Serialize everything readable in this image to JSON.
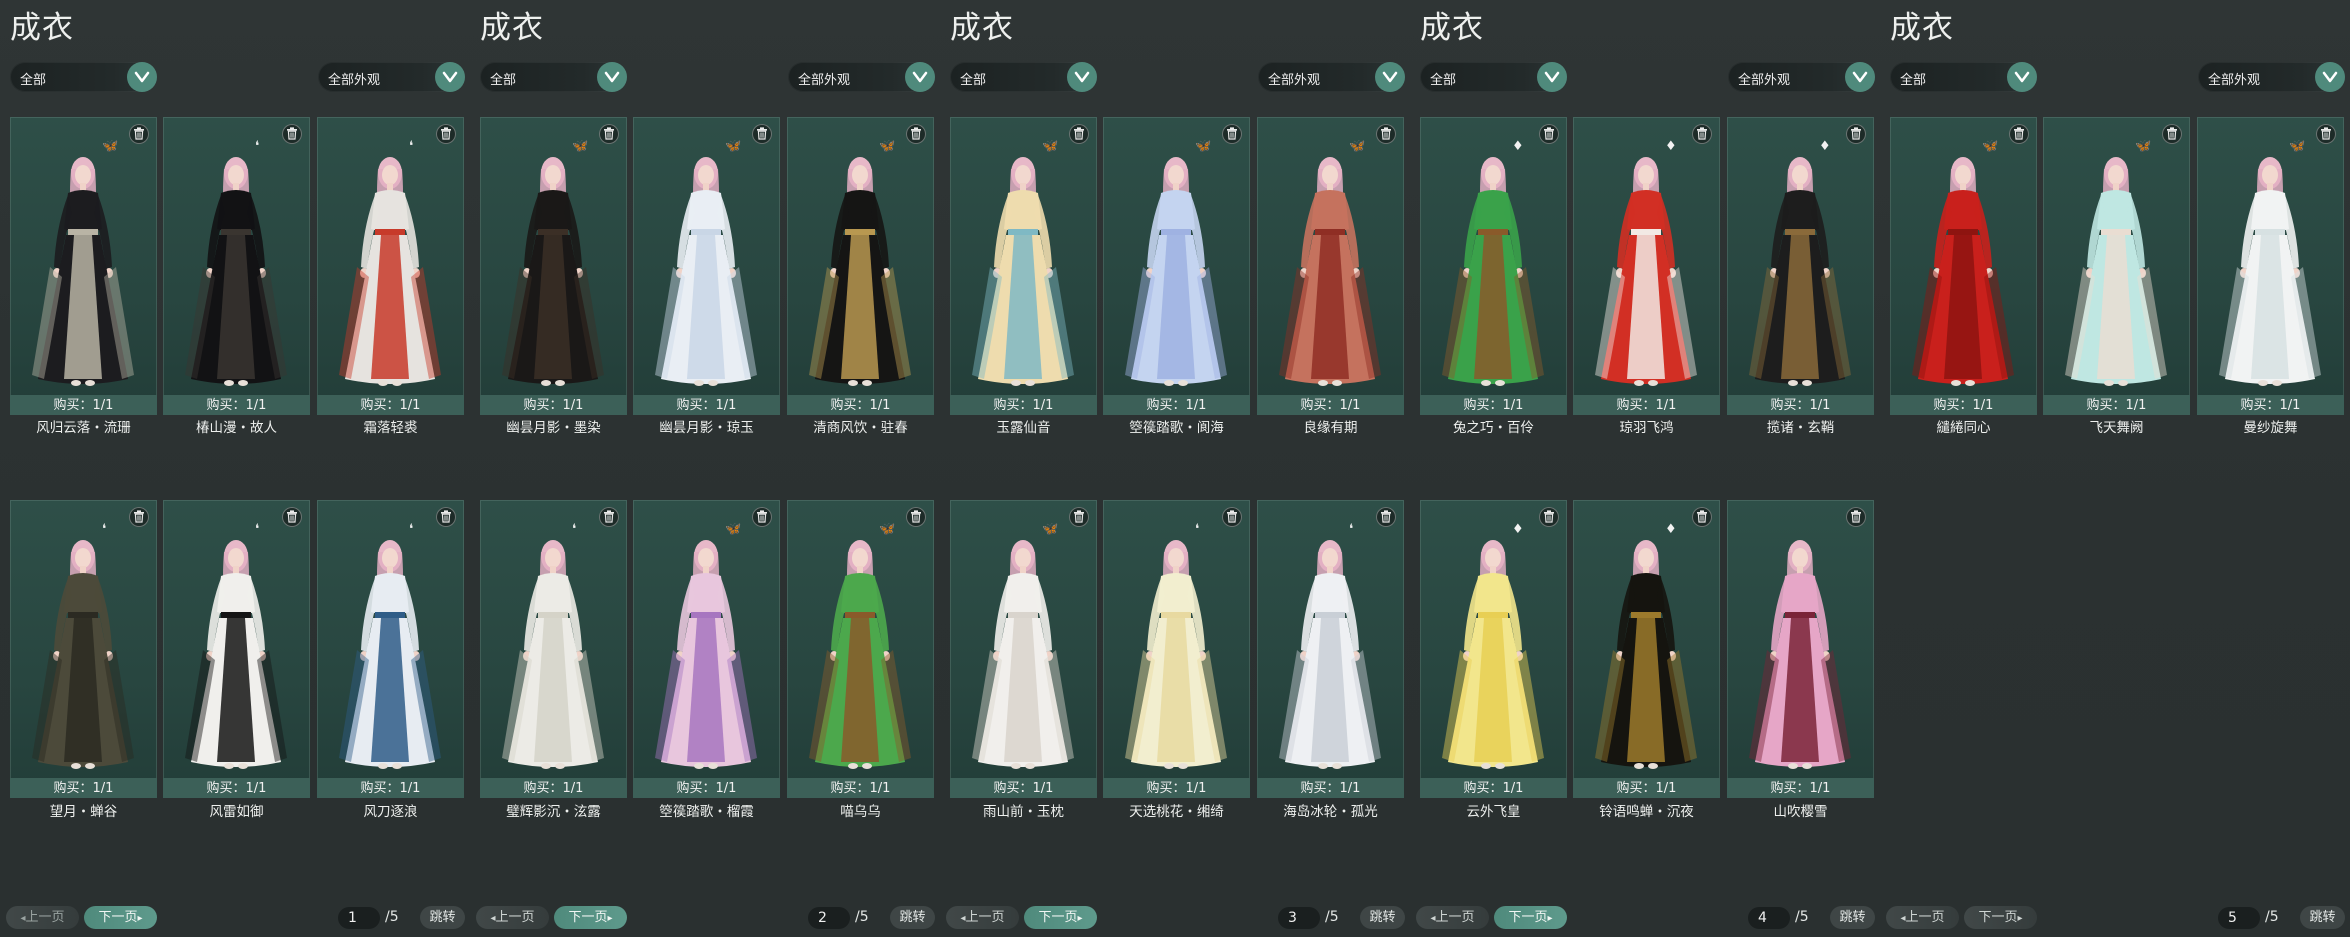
{
  "colors": {
    "accent": "#4f8a7c",
    "panel_bg": "#2c3333",
    "card_bg": "#2e4f48",
    "card_footer": "#3c6058"
  },
  "panels": [
    {
      "title": "成衣",
      "filter_left": "全部",
      "filter_right": "全部外观",
      "pager": {
        "prev": "上一页",
        "next": "下一页",
        "page": "1",
        "total": "/5",
        "jump": "跳转",
        "prev_enabled": false,
        "next_enabled": true
      },
      "cards": [
        {
          "name": "风归云落・流珊",
          "limit": "购买：1/1",
          "icon": "butterfly-icon",
          "dress": [
            "#1c1c1f",
            "#b9b4a5"
          ]
        },
        {
          "name": "椿山漫・故人",
          "limit": "购买：1/1",
          "icon": "feather-icon",
          "dress": [
            "#121214",
            "#3a3530"
          ]
        },
        {
          "name": "霜落轻裘",
          "limit": "购买：1/1",
          "icon": "feather-icon",
          "dress": [
            "#e6e3df",
            "#c73a2a"
          ]
        },
        {
          "name": "望月・蝉谷",
          "limit": "购买：1/1",
          "icon": "feather-icon",
          "dress": [
            "#4c4a3a",
            "#2b2a22"
          ]
        },
        {
          "name": "风雷如御",
          "limit": "购买：1/1",
          "icon": "feather-icon",
          "dress": [
            "#f0efec",
            "#151515"
          ]
        },
        {
          "name": "风刀逐浪",
          "limit": "购买：1/1",
          "icon": "feather-icon",
          "dress": [
            "#e7ecf2",
            "#2f5d88"
          ]
        }
      ]
    },
    {
      "title": "成衣",
      "filter_left": "全部",
      "filter_right": "全部外观",
      "pager": {
        "prev": "上一页",
        "next": "下一页",
        "page": "2",
        "total": "/5",
        "jump": "跳转",
        "prev_enabled": true,
        "next_enabled": true
      },
      "cards": [
        {
          "name": "幽昙月影・墨染",
          "limit": "购买：1/1",
          "icon": "butterfly-icon",
          "dress": [
            "#1a1817",
            "#3b2f26"
          ]
        },
        {
          "name": "幽昙月影・琼玉",
          "limit": "购买：1/1",
          "icon": "butterfly-icon",
          "dress": [
            "#e9eef4",
            "#c9d6e6"
          ]
        },
        {
          "name": "清商风饮・驻春",
          "limit": "购买：1/1",
          "icon": "butterfly-icon",
          "dress": [
            "#151514",
            "#b89850"
          ]
        },
        {
          "name": "璧辉影沉・泫露",
          "limit": "购买：1/1",
          "icon": "feather-icon",
          "dress": [
            "#ecebe6",
            "#d5d3c8"
          ]
        },
        {
          "name": "箜篌踏歌・榴霞",
          "limit": "购买：1/1",
          "icon": "butterfly-icon",
          "dress": [
            "#e8c6dd",
            "#a776c0"
          ]
        },
        {
          "name": "喵乌乌",
          "limit": "购买：1/1",
          "icon": "butterfly-icon",
          "dress": [
            "#4ca84c",
            "#8a5a2a"
          ]
        }
      ]
    },
    {
      "title": "成衣",
      "filter_left": "全部",
      "filter_right": "全部外观",
      "pager": {
        "prev": "上一页",
        "next": "下一页",
        "page": "3",
        "total": "/5",
        "jump": "跳转",
        "prev_enabled": true,
        "next_enabled": true
      },
      "cards": [
        {
          "name": "玉露仙音",
          "limit": "购买：1/1",
          "icon": "butterfly-icon",
          "dress": [
            "#eedcae",
            "#7fb9c4"
          ]
        },
        {
          "name": "箜篌踏歌・阆海",
          "limit": "购买：1/1",
          "icon": "butterfly-icon",
          "dress": [
            "#c4d4f0",
            "#9fb2e2"
          ]
        },
        {
          "name": "良缘有期",
          "limit": "购买：1/1",
          "icon": "butterfly-icon",
          "dress": [
            "#c5725e",
            "#8f2e24"
          ]
        },
        {
          "name": "雨山前・玉枕",
          "limit": "购买：1/1",
          "icon": "butterfly-icon",
          "dress": [
            "#f1efec",
            "#d9d4cd"
          ]
        },
        {
          "name": "天选桃花・缃绮",
          "limit": "购买：1/1",
          "icon": "feather-icon",
          "dress": [
            "#f2eecf",
            "#e8d9a0"
          ]
        },
        {
          "name": "海岛冰轮・孤光",
          "limit": "购买：1/1",
          "icon": "feather-icon",
          "dress": [
            "#eef0f3",
            "#c9cfd6"
          ]
        }
      ]
    },
    {
      "title": "成衣",
      "filter_left": "全部",
      "filter_right": "全部外观",
      "pager": {
        "prev": "上一页",
        "next": "下一页",
        "page": "4",
        "total": "/5",
        "jump": "跳转",
        "prev_enabled": true,
        "next_enabled": true
      },
      "cards": [
        {
          "name": "兔之巧・百伶",
          "limit": "购买：1/1",
          "icon": "bell-icon",
          "dress": [
            "#3aa24a",
            "#8a5a2a"
          ]
        },
        {
          "name": "琼羽飞鸿",
          "limit": "购买：1/1",
          "icon": "bell-icon",
          "dress": [
            "#d22f24",
            "#f2e9e4"
          ]
        },
        {
          "name": "揽诸・玄鞘",
          "limit": "购买：1/1",
          "icon": "bell-icon",
          "dress": [
            "#1d1d1d",
            "#8a6a3a"
          ]
        },
        {
          "name": "云外飞皇",
          "limit": "购买：1/1",
          "icon": "bell-icon",
          "dress": [
            "#f2e68c",
            "#e8cf54"
          ]
        },
        {
          "name": "铃语鸣蝉・沉夜",
          "limit": "购买：1/1",
          "icon": "bell-icon",
          "dress": [
            "#15140f",
            "#9c7a2c"
          ]
        },
        {
          "name": "山吹樱雪",
          "limit": "购买：1/1",
          "icon": "",
          "dress": [
            "#e6a6c7",
            "#7a2438"
          ]
        }
      ]
    },
    {
      "title": "成衣",
      "filter_left": "全部",
      "filter_right": "全部外观",
      "pager": {
        "prev": "上一页",
        "next": "下一页",
        "page": "5",
        "total": "/5",
        "jump": "跳转",
        "prev_enabled": true,
        "next_enabled": false
      },
      "cards": [
        {
          "name": "繾綣同心",
          "limit": "购买：1/1",
          "icon": "butterfly-icon",
          "dress": [
            "#c9201c",
            "#8e1410"
          ]
        },
        {
          "name": "飞天舞阙",
          "limit": "购买：1/1",
          "icon": "butterfly-icon",
          "dress": [
            "#bfe7e2",
            "#e9ddd2"
          ]
        },
        {
          "name": "曼纱旋舞",
          "limit": "购买：1/1",
          "icon": "butterfly-icon",
          "dress": [
            "#f1f3f3",
            "#d7e1e2"
          ]
        }
      ]
    }
  ]
}
